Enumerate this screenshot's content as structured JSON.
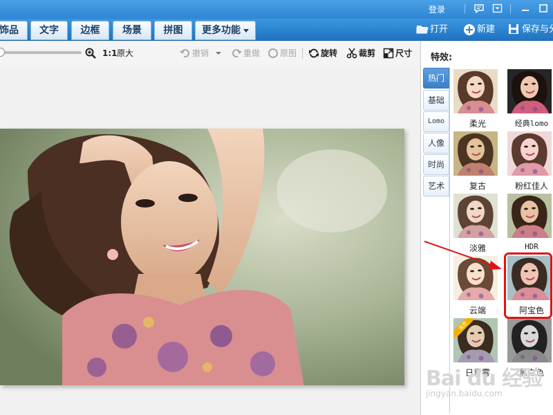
{
  "titlebar": {
    "login": "登录",
    "colors": {
      "bar": "#3590da"
    }
  },
  "tabs": [
    {
      "label": "饰品"
    },
    {
      "label": "文字"
    },
    {
      "label": "边框"
    },
    {
      "label": "场景"
    },
    {
      "label": "拼图"
    },
    {
      "label": "更多功能"
    }
  ],
  "actions": {
    "open": "打开",
    "new": "新建",
    "save": "保存与分"
  },
  "toolbar": {
    "zoom_slider_level": 0,
    "actual_size": "原大",
    "actual_size_prefix": "1:1",
    "undo": "撤销",
    "redo": "重做",
    "original": "原图",
    "rotate": "旋转",
    "crop": "裁剪",
    "resize": "尺寸"
  },
  "panel": {
    "title": "特效:",
    "categories": [
      {
        "label": "热门",
        "active": true
      },
      {
        "label": "基础"
      },
      {
        "label": "Lomo"
      },
      {
        "label": "人像"
      },
      {
        "label": "时尚"
      },
      {
        "label": "艺术"
      }
    ],
    "effects": [
      {
        "label": "柔光"
      },
      {
        "label": "经典lomo"
      },
      {
        "label": "复古"
      },
      {
        "label": "粉红佳人"
      },
      {
        "label": "淡雅"
      },
      {
        "label": "HDR"
      },
      {
        "label": "云端"
      },
      {
        "label": "阿宝色"
      },
      {
        "label": "日青雾",
        "badge": "会员"
      },
      {
        "label": "黑白色"
      }
    ],
    "highlighted_effect": "阿宝色"
  },
  "watermark": {
    "line1": "Bai du 经验",
    "line2": "jingyan.baidu.com"
  },
  "colors": {
    "accent": "#2f86d4",
    "highlight": "#e01313",
    "member_badge": "#f0b400"
  }
}
